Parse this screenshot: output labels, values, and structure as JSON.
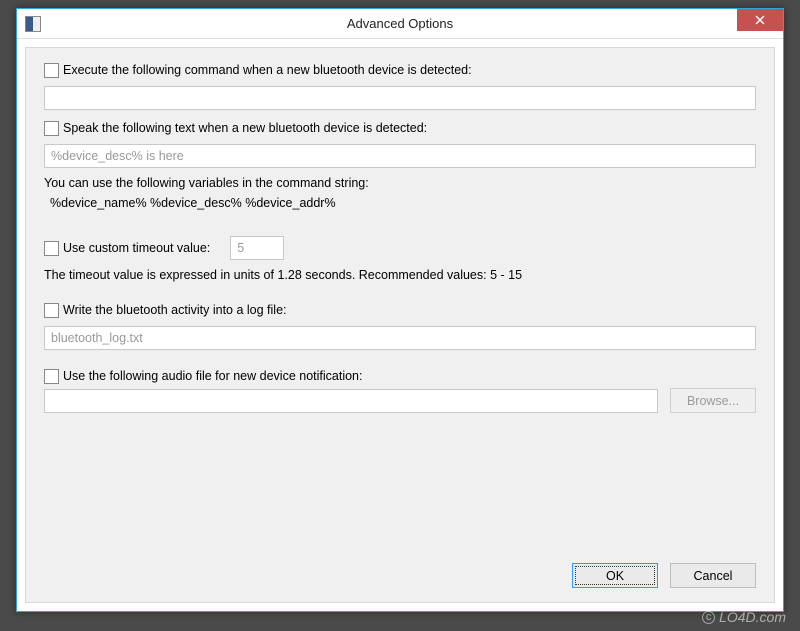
{
  "window": {
    "title": "Advanced Options"
  },
  "execute": {
    "label": "Execute the following command when a new bluetooth device is detected:",
    "value": ""
  },
  "speak": {
    "label": "Speak the following text when a new bluetooth device is detected:",
    "value": "%device_desc% is here"
  },
  "vars_hint": "You can use the following variables in the command string:",
  "vars_list": "%device_name%  %device_desc%  %device_addr%",
  "timeout": {
    "label": "Use custom timeout value:",
    "value": "5",
    "hint": "The timeout value is expressed in units of 1.28 seconds. Recommended values: 5 - 15"
  },
  "log": {
    "label": "Write the bluetooth activity into a log file:",
    "value": "bluetooth_log.txt"
  },
  "audio": {
    "label": "Use the following audio file for new device notification:",
    "value": "",
    "browse": "Browse..."
  },
  "buttons": {
    "ok": "OK",
    "cancel": "Cancel"
  },
  "watermark": "LO4D.com"
}
